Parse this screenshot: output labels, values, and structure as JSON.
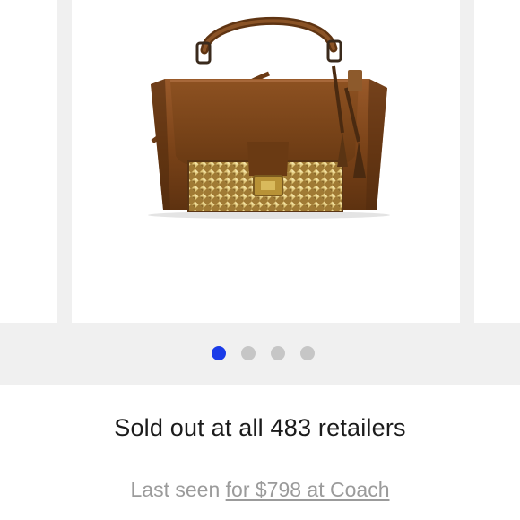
{
  "carousel": {
    "image_alt": "Brown leather handbag with gold studded front flap and tassels",
    "dots": [
      {
        "active": true
      },
      {
        "active": false
      },
      {
        "active": false
      },
      {
        "active": false
      }
    ],
    "active_color": "#1a3be8",
    "inactive_color": "#c6c6c6"
  },
  "status": {
    "text": "Sold out at all 483 retailers"
  },
  "last_seen": {
    "prefix": "Last seen",
    "link_text": "for $798 at Coach"
  }
}
